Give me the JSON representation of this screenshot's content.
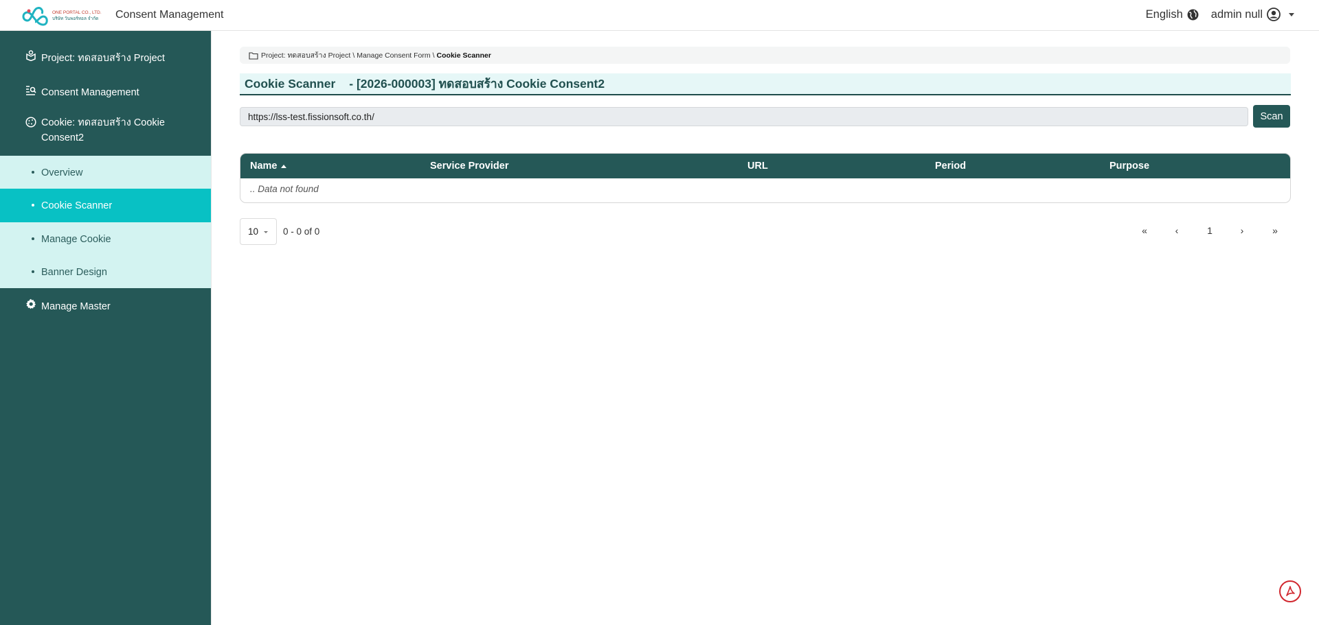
{
  "header": {
    "logo_line1": "ONE PORTAL CO., LTD.",
    "logo_line2": "บริษัท วันพอร์ทอล จำกัด",
    "app_title": "Consent Management",
    "language": "English",
    "language_icon": "globe-icon",
    "user_name": "admin null",
    "user_icon": "user-circle-icon"
  },
  "sidebar": {
    "items": [
      {
        "label": "Project: ทดสอบสร้าง Project",
        "icon": "project-box-icon"
      },
      {
        "label": "Consent Management",
        "icon": "list-search-icon"
      },
      {
        "label_line1": "Cookie: ทดสอบสร้าง Cookie",
        "label_line2": "Consent2",
        "icon": "cookie-icon"
      },
      {
        "label": "Manage Master",
        "icon": "gear-icon"
      }
    ],
    "sub_items": [
      {
        "label": "Overview"
      },
      {
        "label": "Cookie Scanner",
        "active": true
      },
      {
        "label": "Manage Cookie"
      },
      {
        "label": "Banner Design"
      }
    ],
    "colors": {
      "bg": "#255857",
      "sub_bg": "#d3f3f1",
      "active": "#08c1c4"
    }
  },
  "breadcrumb": {
    "icon": "folder-icon",
    "part1": "Project: ทดสอบสร้าง Project",
    "sep": "\\",
    "part2": "Manage Consent Form",
    "current": "Cookie Scanner"
  },
  "page": {
    "title": "Cookie Scanner",
    "subtitle": "- [2026-000003] ทดสอบสร้าง Cookie Consent2"
  },
  "scanner": {
    "url_value": "https://lss-test.fissionsoft.co.th/",
    "scan_label": "Scan"
  },
  "table": {
    "columns": [
      "Name",
      "Service Provider",
      "URL",
      "Period",
      "Purpose"
    ],
    "sorted_column": "Name",
    "empty_text": ".. Data not found"
  },
  "pagination": {
    "page_size": "10",
    "range_text": "0 - 0 of 0",
    "first": "«",
    "prev": "‹",
    "current_page": "1",
    "next": "›",
    "last": "»"
  },
  "floating": {
    "pdf_icon": "acrobat-pdf-icon"
  }
}
